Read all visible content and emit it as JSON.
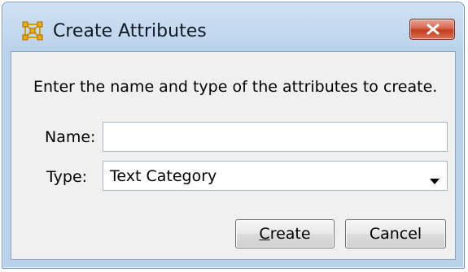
{
  "window": {
    "title": "Create Attributes",
    "instruction": "Enter the name and type of the attributes to create."
  },
  "form": {
    "name_label": "Name:",
    "name_value": "",
    "type_label": "Type:",
    "type_value": "Text Category"
  },
  "buttons": {
    "create_mnemonic": "C",
    "create_rest": "reate",
    "cancel_label": "Cancel"
  },
  "colors": {
    "titlebar": "#c2d8ee",
    "client_background": "#f0f0f0",
    "close_button": "#c43c1e",
    "app_icon": "#e8b400"
  },
  "icons": {
    "app": "network-grid-icon",
    "close": "close-icon",
    "dropdown": "chevron-down-icon"
  }
}
